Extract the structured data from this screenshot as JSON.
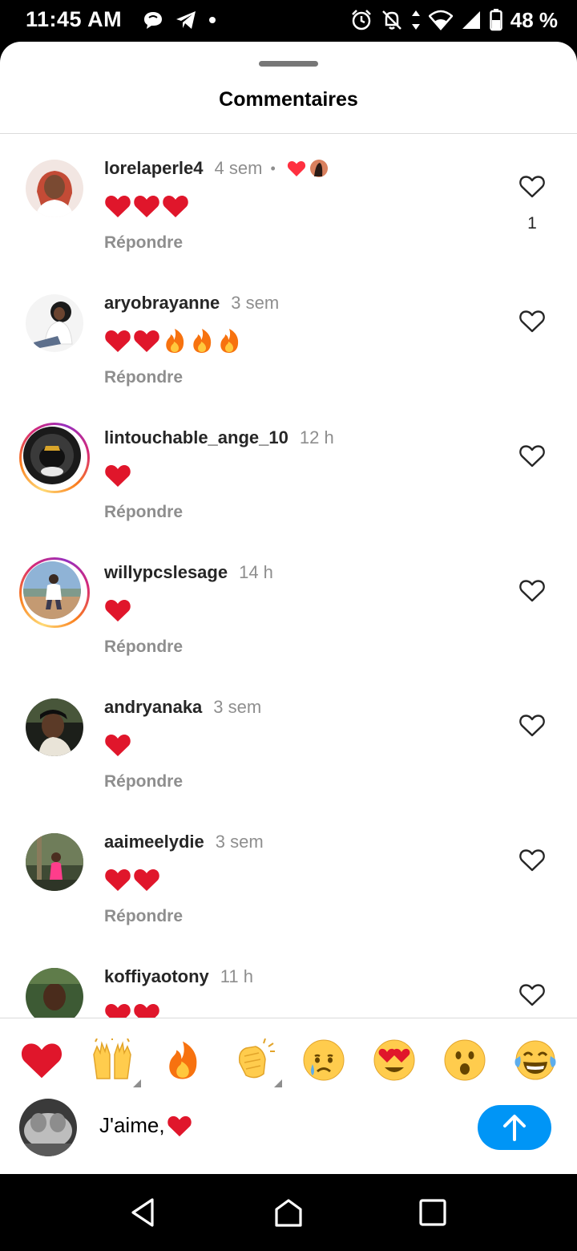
{
  "status_bar": {
    "time": "11:45 AM",
    "battery": "48 %"
  },
  "sheet": {
    "title": "Commentaires"
  },
  "reply_label": "Répondre",
  "comments": [
    {
      "username": "lorelaperle4",
      "time": "4 sem",
      "liked_by_author": true,
      "like_count": "1",
      "emojis": [
        "heart",
        "heart",
        "heart"
      ]
    },
    {
      "username": "aryobrayanne",
      "time": "3 sem",
      "emojis": [
        "heart",
        "heart",
        "fire",
        "fire",
        "fire"
      ]
    },
    {
      "username": "lintouchable_ange_10",
      "time": "12 h",
      "story_ring": true,
      "emojis": [
        "heart"
      ]
    },
    {
      "username": "willypcslesage",
      "time": "14 h",
      "story_ring": true,
      "emojis": [
        "heart"
      ]
    },
    {
      "username": "andryanaka",
      "time": "3 sem",
      "emojis": [
        "heart"
      ]
    },
    {
      "username": "aaimeelydie",
      "time": "3 sem",
      "emojis": [
        "heart",
        "heart"
      ]
    },
    {
      "username": "koffiyaotony",
      "time": "11 h",
      "emojis": [
        "heart",
        "heart"
      ]
    }
  ],
  "quick_reactions": [
    "red-heart",
    "raising-hands",
    "fire",
    "clapping-hands",
    "crying-face",
    "heart-eyes-face",
    "surprised-face",
    "tears-of-joy-face"
  ],
  "composer": {
    "text": "J'aime,",
    "trailing_emoji": "heart"
  },
  "colors": {
    "accent": "#0095f6",
    "heart": "#e0162b",
    "muted": "#8e8e8e"
  }
}
